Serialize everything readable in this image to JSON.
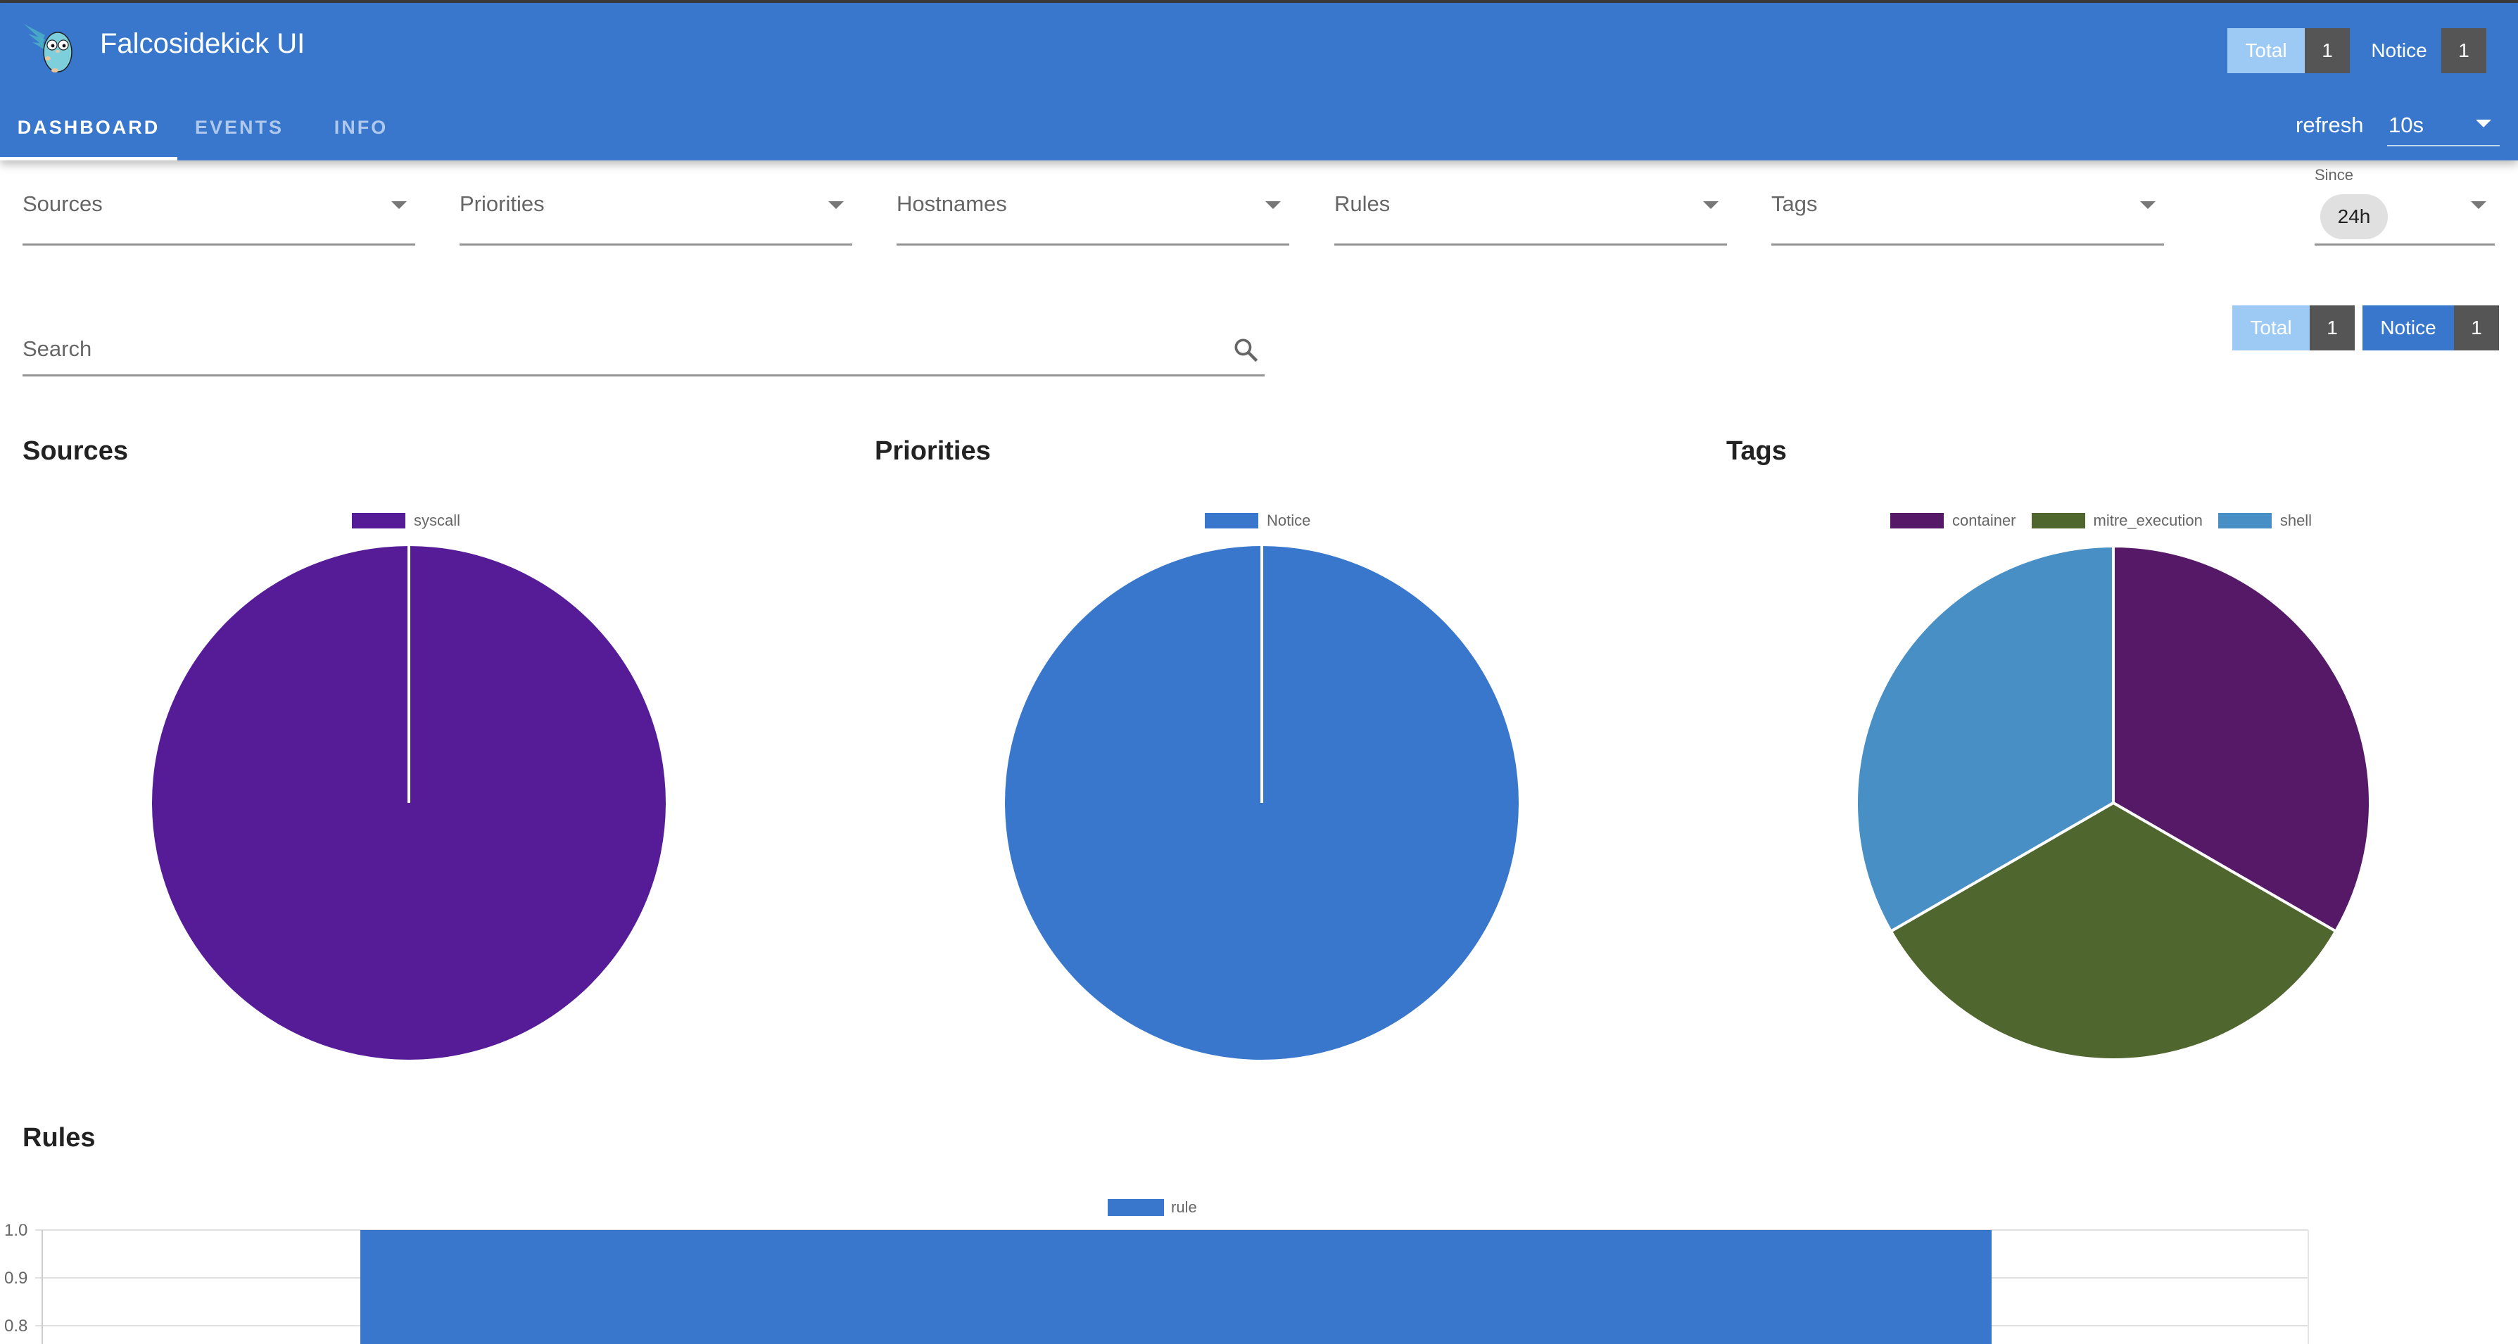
{
  "app": {
    "title": "Falcosidekick UI",
    "logo_icon": "gopher-logo-icon"
  },
  "nav": {
    "tabs": [
      {
        "label": "DASHBOARD",
        "active": true
      },
      {
        "label": "EVENTS",
        "active": false
      },
      {
        "label": "INFO",
        "active": false
      }
    ]
  },
  "header_counters": {
    "total": {
      "label": "Total",
      "count": "1"
    },
    "notice": {
      "label": "Notice",
      "count": "1"
    }
  },
  "refresh": {
    "label": "refresh",
    "value": "10s"
  },
  "filters": {
    "sources": "Sources",
    "priorities": "Priorities",
    "hostnames": "Hostnames",
    "rules": "Rules",
    "tags": "Tags",
    "since": {
      "caption": "Since",
      "value": "24h"
    }
  },
  "search": {
    "placeholder": "Search",
    "value": ""
  },
  "counters": {
    "total": {
      "label": "Total",
      "count": "1"
    },
    "notice": {
      "label": "Notice",
      "count": "1"
    }
  },
  "colors": {
    "primary": "#3877cc",
    "total_chip": "#9ccaf5",
    "count_chip": "#555555"
  },
  "chart_data": [
    {
      "type": "pie",
      "title": "Sources",
      "legend": "top",
      "labels": [
        "syscall"
      ],
      "values": [
        1
      ],
      "colors": [
        "#561c97"
      ]
    },
    {
      "type": "pie",
      "title": "Priorities",
      "legend": "top",
      "labels": [
        "Notice"
      ],
      "values": [
        1
      ],
      "colors": [
        "#3877cc"
      ]
    },
    {
      "type": "pie",
      "title": "Tags",
      "legend": "top",
      "labels": [
        "container",
        "mitre_execution",
        "shell"
      ],
      "values": [
        1,
        1,
        1
      ],
      "colors": [
        "#561967",
        "#4f672e",
        "#478fc5"
      ]
    },
    {
      "type": "bar",
      "title": "Rules",
      "legend": "top",
      "series": [
        {
          "name": "rule",
          "values": [
            1
          ],
          "color": "#3877cc"
        }
      ],
      "categories": [
        ""
      ],
      "yticks": [
        "1.0",
        "0.9",
        "0.8"
      ],
      "ylim": [
        0,
        1
      ],
      "grid": true
    }
  ]
}
